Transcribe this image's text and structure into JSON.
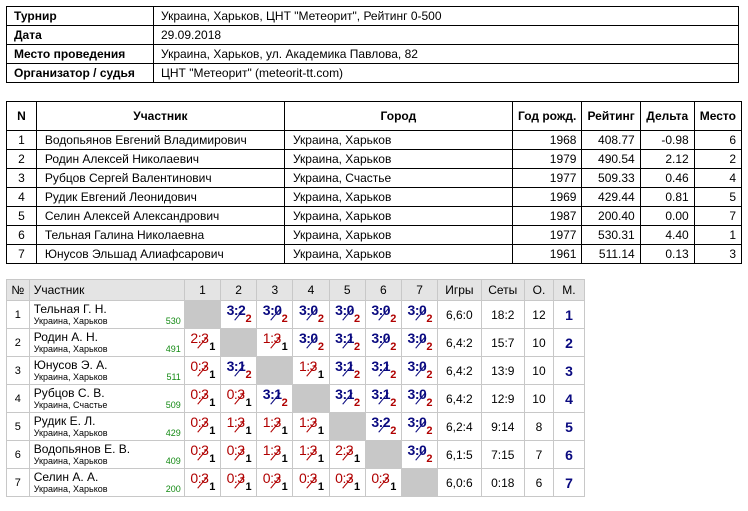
{
  "info": [
    {
      "key": "Турнир",
      "value": "Украина, Харьков, ЦНТ \"Метеорит\", Рейтинг 0-500"
    },
    {
      "key": "Дата",
      "value": "29.09.2018"
    },
    {
      "key": "Место проведения",
      "value": "Украина, Харьков, ул. Академика Павлова, 82"
    },
    {
      "key": "Организатор / судья",
      "value": "ЦНТ \"Метеорит\" (meteorit-tt.com)"
    }
  ],
  "participants": {
    "headers": [
      "N",
      "Участник",
      "Город",
      "Год рожд.",
      "Рейтинг",
      "Дельта",
      "Место"
    ],
    "rows": [
      [
        "1",
        "Водопьянов Евгений Владимирович",
        "Украина, Харьков",
        "1968",
        "408.77",
        "-0.98",
        "6"
      ],
      [
        "2",
        "Родин Алексей Николаевич",
        "Украина, Харьков",
        "1979",
        "490.54",
        "2.12",
        "2"
      ],
      [
        "3",
        "Рубцов Сергей Валентинович",
        "Украина, Счастье",
        "1977",
        "509.33",
        "0.46",
        "4"
      ],
      [
        "4",
        "Рудик Евгений Леонидович",
        "Украина, Харьков",
        "1969",
        "429.44",
        "0.81",
        "5"
      ],
      [
        "5",
        "Селин Алексей Александрович",
        "Украина, Харьков",
        "1987",
        "200.40",
        "0.00",
        "7"
      ],
      [
        "6",
        "Тельная Галина Николаевна",
        "Украина, Харьков",
        "1977",
        "530.31",
        "4.40",
        "1"
      ],
      [
        "7",
        "Юнусов Эльшад Алиафсарович",
        "Украина, Харьков",
        "1961",
        "511.14",
        "0.13",
        "3"
      ]
    ]
  },
  "cross": {
    "headers": {
      "num": "№",
      "player": "Участник",
      "cols": [
        "1",
        "2",
        "3",
        "4",
        "5",
        "6",
        "7"
      ],
      "games": "Игры",
      "sets": "Сеты",
      "points": "О.",
      "place": "М."
    },
    "rows": [
      {
        "n": "1",
        "name": "Тельная Г. Н.",
        "city": "Украина, Харьков",
        "rating": "530",
        "cells": [
          null,
          {
            "s": "3:2",
            "p": "2",
            "w": true
          },
          {
            "s": "3:0",
            "p": "2",
            "w": true
          },
          {
            "s": "3:0",
            "p": "2",
            "w": true
          },
          {
            "s": "3:0",
            "p": "2",
            "w": true
          },
          {
            "s": "3:0",
            "p": "2",
            "w": true
          },
          {
            "s": "3:0",
            "p": "2",
            "w": true
          }
        ],
        "games": "6,6:0",
        "sets": "18:2",
        "points": "12",
        "place": "1"
      },
      {
        "n": "2",
        "name": "Родин А. Н.",
        "city": "Украина, Харьков",
        "rating": "491",
        "cells": [
          {
            "s": "2:3",
            "p": "1",
            "w": false
          },
          null,
          {
            "s": "1:3",
            "p": "1",
            "w": false
          },
          {
            "s": "3:0",
            "p": "2",
            "w": true
          },
          {
            "s": "3:1",
            "p": "2",
            "w": true
          },
          {
            "s": "3:0",
            "p": "2",
            "w": true
          },
          {
            "s": "3:0",
            "p": "2",
            "w": true
          }
        ],
        "games": "6,4:2",
        "sets": "15:7",
        "points": "10",
        "place": "2"
      },
      {
        "n": "3",
        "name": "Юнусов Э. А.",
        "city": "Украина, Харьков",
        "rating": "511",
        "cells": [
          {
            "s": "0:3",
            "p": "1",
            "w": false
          },
          {
            "s": "3:1",
            "p": "2",
            "w": true
          },
          null,
          {
            "s": "1:3",
            "p": "1",
            "w": false
          },
          {
            "s": "3:1",
            "p": "2",
            "w": true
          },
          {
            "s": "3:1",
            "p": "2",
            "w": true
          },
          {
            "s": "3:0",
            "p": "2",
            "w": true
          }
        ],
        "games": "6,4:2",
        "sets": "13:9",
        "points": "10",
        "place": "3"
      },
      {
        "n": "4",
        "name": "Рубцов С. В.",
        "city": "Украина, Счастье",
        "rating": "509",
        "cells": [
          {
            "s": "0:3",
            "p": "1",
            "w": false
          },
          {
            "s": "0:3",
            "p": "1",
            "w": false
          },
          {
            "s": "3:1",
            "p": "2",
            "w": true
          },
          null,
          {
            "s": "3:1",
            "p": "2",
            "w": true
          },
          {
            "s": "3:1",
            "p": "2",
            "w": true
          },
          {
            "s": "3:0",
            "p": "2",
            "w": true
          }
        ],
        "games": "6,4:2",
        "sets": "12:9",
        "points": "10",
        "place": "4"
      },
      {
        "n": "5",
        "name": "Рудик Е. Л.",
        "city": "Украина, Харьков",
        "rating": "429",
        "cells": [
          {
            "s": "0:3",
            "p": "1",
            "w": false
          },
          {
            "s": "1:3",
            "p": "1",
            "w": false
          },
          {
            "s": "1:3",
            "p": "1",
            "w": false
          },
          {
            "s": "1:3",
            "p": "1",
            "w": false
          },
          null,
          {
            "s": "3:2",
            "p": "2",
            "w": true
          },
          {
            "s": "3:0",
            "p": "2",
            "w": true
          }
        ],
        "games": "6,2:4",
        "sets": "9:14",
        "points": "8",
        "place": "5"
      },
      {
        "n": "6",
        "name": "Водопьянов Е. В.",
        "city": "Украина, Харьков",
        "rating": "409",
        "cells": [
          {
            "s": "0:3",
            "p": "1",
            "w": false
          },
          {
            "s": "0:3",
            "p": "1",
            "w": false
          },
          {
            "s": "1:3",
            "p": "1",
            "w": false
          },
          {
            "s": "1:3",
            "p": "1",
            "w": false
          },
          {
            "s": "2:3",
            "p": "1",
            "w": false
          },
          null,
          {
            "s": "3:0",
            "p": "2",
            "w": true
          }
        ],
        "games": "6,1:5",
        "sets": "7:15",
        "points": "7",
        "place": "6"
      },
      {
        "n": "7",
        "name": "Селин А. А.",
        "city": "Украина, Харьков",
        "rating": "200",
        "cells": [
          {
            "s": "0:3",
            "p": "1",
            "w": false
          },
          {
            "s": "0:3",
            "p": "1",
            "w": false
          },
          {
            "s": "0:3",
            "p": "1",
            "w": false
          },
          {
            "s": "0:3",
            "p": "1",
            "w": false
          },
          {
            "s": "0:3",
            "p": "1",
            "w": false
          },
          {
            "s": "0:3",
            "p": "1",
            "w": false
          },
          null
        ],
        "games": "6,0:6",
        "sets": "0:18",
        "points": "6",
        "place": "7"
      }
    ]
  }
}
